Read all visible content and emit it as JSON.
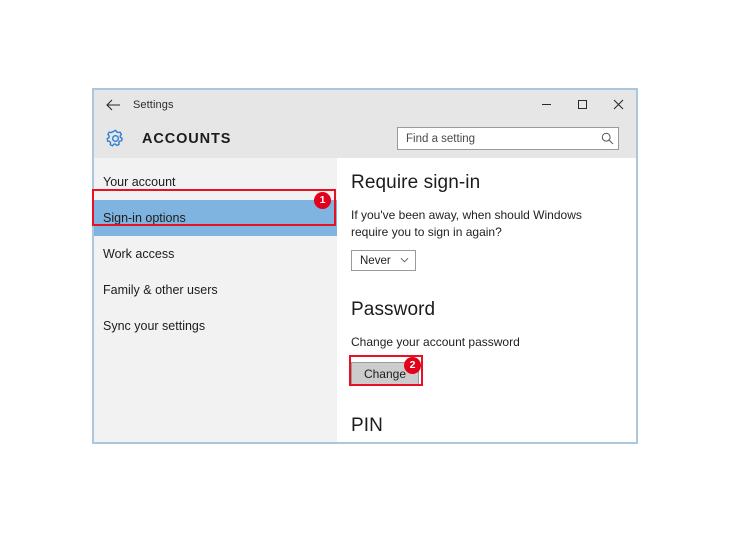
{
  "window": {
    "title": "Settings",
    "back_icon": "back-arrow-icon",
    "controls": {
      "minimize": "minimize-icon",
      "maximize": "maximize-icon",
      "close": "close-icon"
    }
  },
  "header": {
    "icon": "gear-icon",
    "title": "ACCOUNTS"
  },
  "search": {
    "placeholder": "Find a setting",
    "value": "",
    "icon": "search-icon"
  },
  "sidebar": {
    "items": [
      {
        "label": "Your account",
        "selected": false
      },
      {
        "label": "Sign-in options",
        "selected": true
      },
      {
        "label": "Work access",
        "selected": false
      },
      {
        "label": "Family & other users",
        "selected": false
      },
      {
        "label": "Sync your settings",
        "selected": false
      }
    ]
  },
  "main": {
    "require_signin": {
      "heading": "Require sign-in",
      "description": "If you've been away, when should Windows require you to sign in again?",
      "dropdown_value": "Never",
      "dropdown_icon": "chevron-down-icon"
    },
    "password": {
      "heading": "Password",
      "description": "Change your account password",
      "button_label": "Change"
    },
    "pin": {
      "heading": "PIN"
    }
  },
  "annotations": {
    "badge_1": "1",
    "badge_2": "2"
  },
  "colors": {
    "accent_red": "#e3001b",
    "selection_blue": "#7fb4e0",
    "gear_blue": "#2d7dd2",
    "window_border": "#a9c7de",
    "header_gray": "#e6e6e6",
    "sidebar_gray": "#f2f2f2"
  }
}
